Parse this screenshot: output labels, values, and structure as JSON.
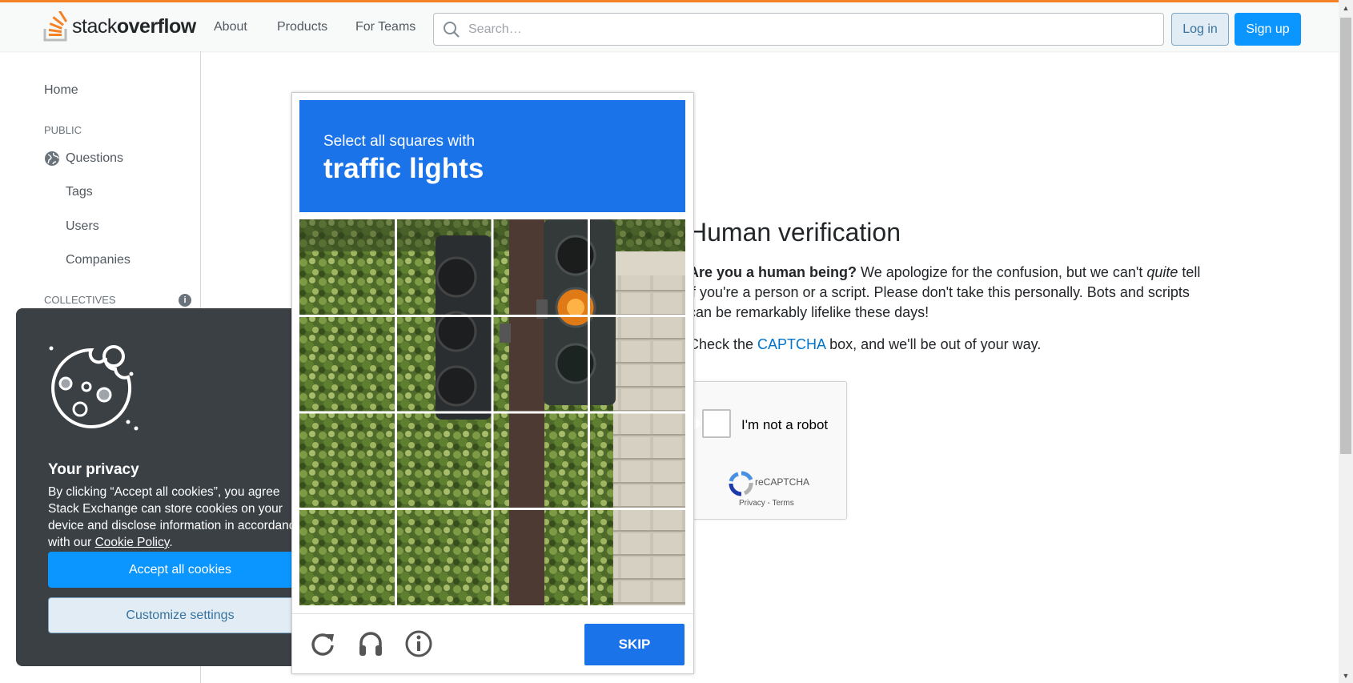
{
  "header": {
    "logo_text_light": "stack",
    "logo_text_bold": "overflow",
    "nav": [
      "About",
      "Products",
      "For Teams"
    ],
    "search_placeholder": "Search…",
    "login_label": "Log in",
    "signup_label": "Sign up",
    "accent_color": "#f48225"
  },
  "sidebar": {
    "home": "Home",
    "public_heading": "PUBLIC",
    "questions": "Questions",
    "tags": "Tags",
    "users": "Users",
    "companies": "Companies",
    "collectives_heading": "COLLECTIVES",
    "collectives_info_icon": "info-icon"
  },
  "main": {
    "title": "Human verification",
    "lead_bold": "Are you a human being?",
    "lead_rest_1": " We apologize for the confusion, but we can't ",
    "lead_italic": "quite",
    "lead_rest_2": " tell if you're a person or a script. Please don't take this personally. Bots and scripts can be remarkably lifelike these days!",
    "check_prefix": "Check the ",
    "check_link": "CAPTCHA",
    "check_suffix": " box, and we'll be out of your way.",
    "recaptcha_label": "I'm not a robot",
    "recaptcha_brand": "reCAPTCHA",
    "recaptcha_terms": "Privacy - Terms"
  },
  "cookie": {
    "title": "Your privacy",
    "text_part1": "By clicking “Accept all cookies”, you agree Stack Exchange can store cookies on your device and disclose information in accordance with our ",
    "policy_link": "Cookie Policy",
    "text_end": ".",
    "accept_label": "Accept all cookies",
    "customize_label": "Customize settings"
  },
  "challenge": {
    "instruction": "Select all squares with",
    "target": "traffic lights",
    "skip_label": "SKIP",
    "tools": [
      "reload-icon",
      "audio-icon",
      "info-icon"
    ],
    "header_color": "#1a73e8"
  }
}
